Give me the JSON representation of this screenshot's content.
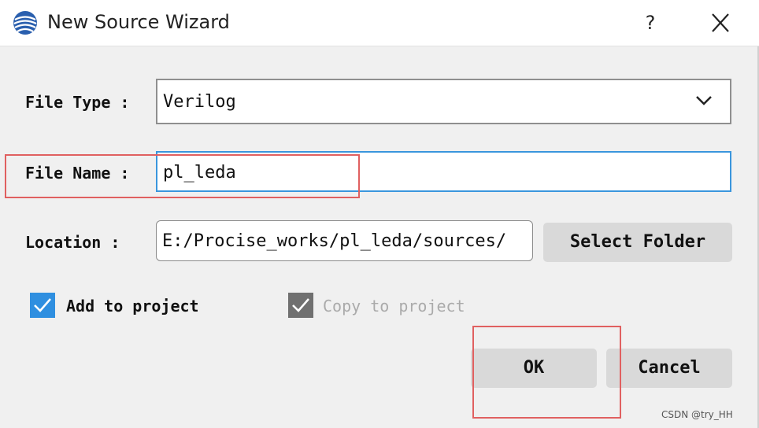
{
  "window": {
    "title": "New Source Wizard",
    "help_label": "?",
    "icon": "wizard-sphere-icon",
    "close_icon": "close-icon"
  },
  "form": {
    "file_type_label": "File Type :",
    "file_type_value": "Verilog",
    "file_name_label": "File Name :",
    "file_name_value": "pl_leda",
    "location_label": "Location :",
    "location_value": "E:/Procise_works/pl_leda/sources/",
    "select_folder_label": "Select Folder",
    "add_to_project_label": "Add to project",
    "add_to_project_checked": true,
    "copy_to_project_label": "Copy to project",
    "copy_to_project_checked": true,
    "copy_to_project_enabled": false
  },
  "buttons": {
    "ok_label": "OK",
    "cancel_label": "Cancel"
  },
  "watermark": "CSDN @try_HH",
  "colors": {
    "accent": "#2f8fe0",
    "focus_border": "#3a96dd",
    "annotation": "#e06060",
    "disabled": "#707070"
  }
}
